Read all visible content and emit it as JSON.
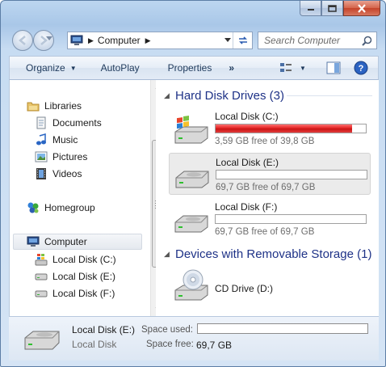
{
  "window": {
    "controls": [
      "minimize",
      "maximize",
      "close"
    ]
  },
  "address": {
    "crumb": "Computer",
    "search_placeholder": "Search Computer"
  },
  "toolbar": {
    "organize": "Organize",
    "autoplay": "AutoPlay",
    "properties": "Properties",
    "more": "»"
  },
  "nav": {
    "libraries": "Libraries",
    "documents": "Documents",
    "music": "Music",
    "pictures": "Pictures",
    "videos": "Videos",
    "homegroup": "Homegroup",
    "computer": "Computer",
    "drive_c": "Local Disk (C:)",
    "drive_e": "Local Disk (E:)",
    "drive_f": "Local Disk (F:)"
  },
  "content": {
    "hdd_group": "Hard Disk Drives (3)",
    "removable_group": "Devices with Removable Storage (1)",
    "drives": [
      {
        "name": "Local Disk (C:)",
        "free": "3,59 GB free of 39,8 GB",
        "used_fraction": 0.91,
        "icon": "windows-drive-icon"
      },
      {
        "name": "Local Disk (E:)",
        "free": "69,7 GB free of 69,7 GB",
        "used_fraction": 0.0,
        "icon": "hard-drive-icon"
      },
      {
        "name": "Local Disk (F:)",
        "free": "69,7 GB free of 69,7 GB",
        "used_fraction": 0.0,
        "icon": "hard-drive-icon"
      }
    ],
    "cd": {
      "name": "CD Drive (D:)",
      "icon": "cd-drive-icon"
    }
  },
  "details": {
    "name": "Local Disk (E:)",
    "type": "Local Disk",
    "space_used_label": "Space used:",
    "space_free_label": "Space free:",
    "space_free_value": "69,7 GB",
    "used_fraction": 0.0
  },
  "colors": {
    "accent_header": "#1e3287",
    "bar_full": "#de1d1d"
  }
}
